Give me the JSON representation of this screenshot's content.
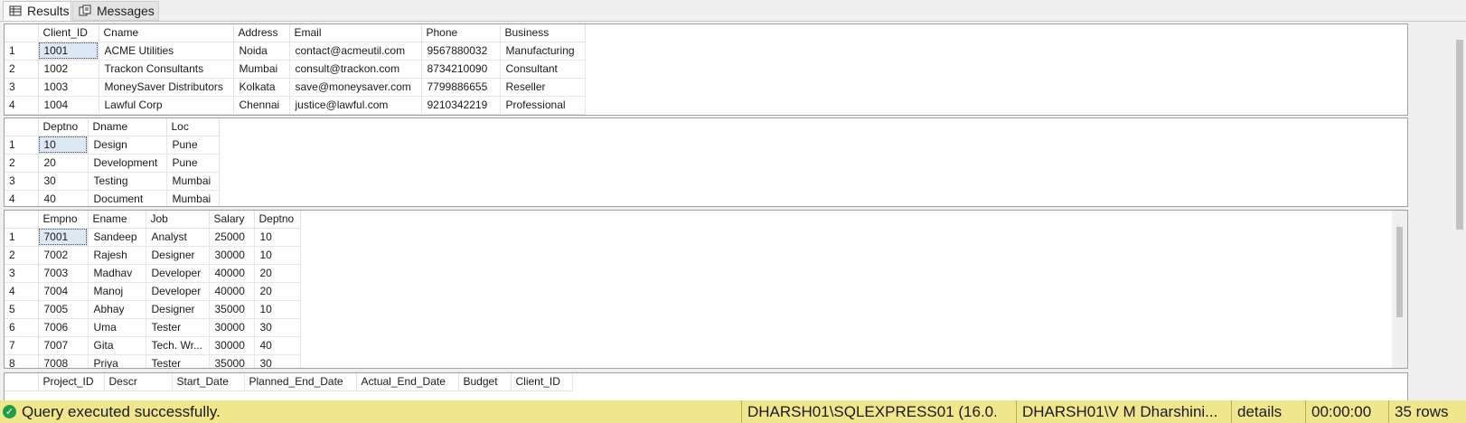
{
  "tabs": [
    {
      "label": "Results",
      "icon": "grid-icon"
    },
    {
      "label": "Messages",
      "icon": "messages-icon"
    }
  ],
  "grid1": {
    "columns": [
      "Client_ID",
      "Cname",
      "Address",
      "Email",
      "Phone",
      "Business"
    ],
    "rows": [
      [
        "1",
        "1001",
        "ACME Utilities",
        "Noida",
        "contact@acmeutil.com",
        "9567880032",
        "Manufacturing"
      ],
      [
        "2",
        "1002",
        "Trackon Consultants",
        "Mumbai",
        "consult@trackon.com",
        "8734210090",
        "Consultant"
      ],
      [
        "3",
        "1003",
        "MoneySaver Distributors",
        "Kolkata",
        "save@moneysaver.com",
        "7799886655",
        "Reseller"
      ],
      [
        "4",
        "1004",
        "Lawful Corp",
        "Chennai",
        "justice@lawful.com",
        "9210342219",
        "Professional"
      ]
    ]
  },
  "grid2": {
    "columns": [
      "Deptno",
      "Dname",
      "Loc"
    ],
    "rows": [
      [
        "1",
        "10",
        "Design",
        "Pune"
      ],
      [
        "2",
        "20",
        "Development",
        "Pune"
      ],
      [
        "3",
        "30",
        "Testing",
        "Mumbai"
      ],
      [
        "4",
        "40",
        "Document",
        "Mumbai"
      ]
    ]
  },
  "grid3": {
    "columns": [
      "Empno",
      "Ename",
      "Job",
      "Salary",
      "Deptno"
    ],
    "rows": [
      [
        "1",
        "7001",
        "Sandeep",
        "Analyst",
        "25000",
        "10"
      ],
      [
        "2",
        "7002",
        "Rajesh",
        "Designer",
        "30000",
        "10"
      ],
      [
        "3",
        "7003",
        "Madhav",
        "Developer",
        "40000",
        "20"
      ],
      [
        "4",
        "7004",
        "Manoj",
        "Developer",
        "40000",
        "20"
      ],
      [
        "5",
        "7005",
        "Abhay",
        "Designer",
        "35000",
        "10"
      ],
      [
        "6",
        "7006",
        "Uma",
        "Tester",
        "30000",
        "30"
      ],
      [
        "7",
        "7007",
        "Gita",
        "Tech. Wr...",
        "30000",
        "40"
      ],
      [
        "8",
        "7008",
        "Priya",
        "Tester",
        "35000",
        "30"
      ]
    ]
  },
  "grid4": {
    "columns": [
      "Project_ID",
      "Descr",
      "Start_Date",
      "Planned_End_Date",
      "Actual_End_Date",
      "Budget",
      "Client_ID"
    ]
  },
  "status": {
    "message": "Query executed successfully.",
    "server": "DHARSH01\\SQLEXPRESS01 (16.0...",
    "user": "DHARSH01\\V M Dharshini...",
    "database": "details",
    "elapsed": "00:00:00",
    "rows": "35 rows"
  },
  "colors": {
    "status_bg": "#f0e68c",
    "success": "#1e9e4a",
    "selection": "#dde8f5"
  }
}
